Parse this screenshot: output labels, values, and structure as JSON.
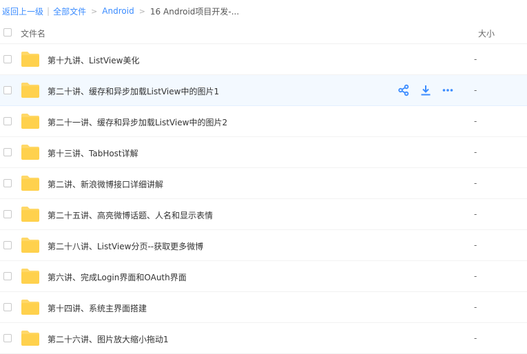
{
  "breadcrumb": {
    "back": "返回上一级",
    "all_files": "全部文件",
    "folder": "Android",
    "current": "16 Android项目开发-...",
    "arrow": ">"
  },
  "table": {
    "col_name": "文件名",
    "col_size": "大小"
  },
  "rows": [
    {
      "name": "第十九讲、ListView美化",
      "size": "-"
    },
    {
      "name": "第二十讲、缓存和异步加载ListView中的图片1",
      "size": "-",
      "hovered": true
    },
    {
      "name": "第二十一讲、缓存和异步加载ListView中的图片2",
      "size": "-"
    },
    {
      "name": "第十三讲、TabHost详解",
      "size": "-"
    },
    {
      "name": "第二讲、新浪微博接口详细讲解",
      "size": "-"
    },
    {
      "name": "第二十五讲、高亮微博话题、人名和显示表情",
      "size": "-"
    },
    {
      "name": "第二十八讲、ListView分页--获取更多微博",
      "size": "-"
    },
    {
      "name": "第六讲、完成Login界面和OAuth界面",
      "size": "-"
    },
    {
      "name": "第十四讲、系统主界面搭建",
      "size": "-"
    },
    {
      "name": "第二十六讲、图片放大缩小拖动1",
      "size": "-"
    }
  ],
  "row_actions": [
    "share-icon",
    "download-icon",
    "more-icon"
  ],
  "colors": {
    "link": "#3b8cff",
    "folder": "#ffd14d",
    "hover_row": "#f3f9ff"
  }
}
